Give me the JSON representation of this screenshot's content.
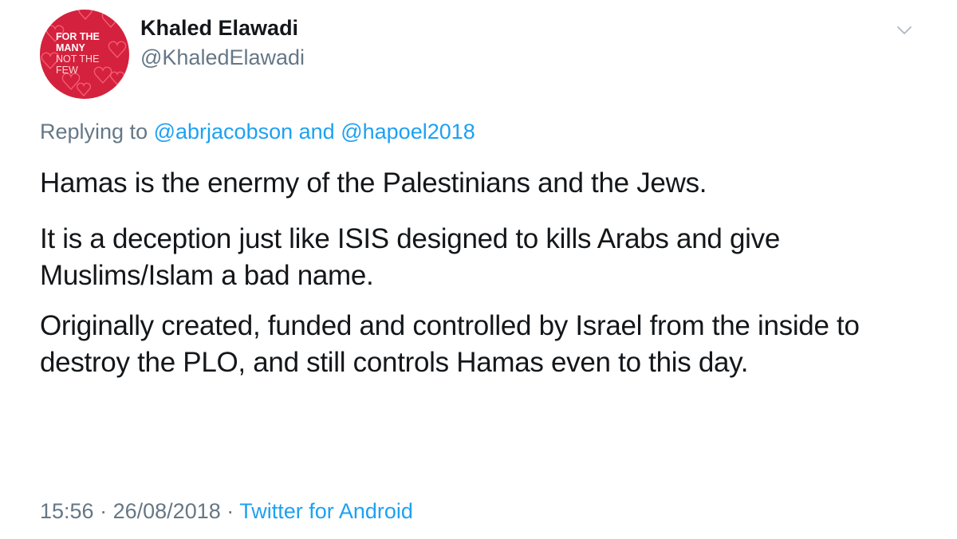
{
  "author": {
    "display_name": "Khaled Elawadi",
    "handle": "@KhaledElawadi",
    "avatar": {
      "line1": "FOR THE",
      "line2": "MANY",
      "line3": "NOT THE",
      "line4": "FEW",
      "color": "#d4213d"
    }
  },
  "menu_icon": "chevron-down-icon",
  "reply": {
    "prefix": "Replying to",
    "mention1": "@abrjacobson",
    "joiner": "and",
    "mention2": "@hapoel2018"
  },
  "paragraphs": [
    "Hamas is the enermy of the Palestinians and the Jews.",
    "It is a deception just like ISIS designed to kills Arabs and give Muslims/Islam a bad name.",
    "Originally created, funded and controlled by Israel from the inside to destroy the PLO, and still controls Hamas even to this day."
  ],
  "meta": {
    "time": "15:56",
    "separator": "·",
    "date": "26/08/2018",
    "source": "Twitter for Android"
  },
  "colors": {
    "link": "#1da1f2",
    "secondary_text": "#657786",
    "primary_text": "#14171a"
  }
}
